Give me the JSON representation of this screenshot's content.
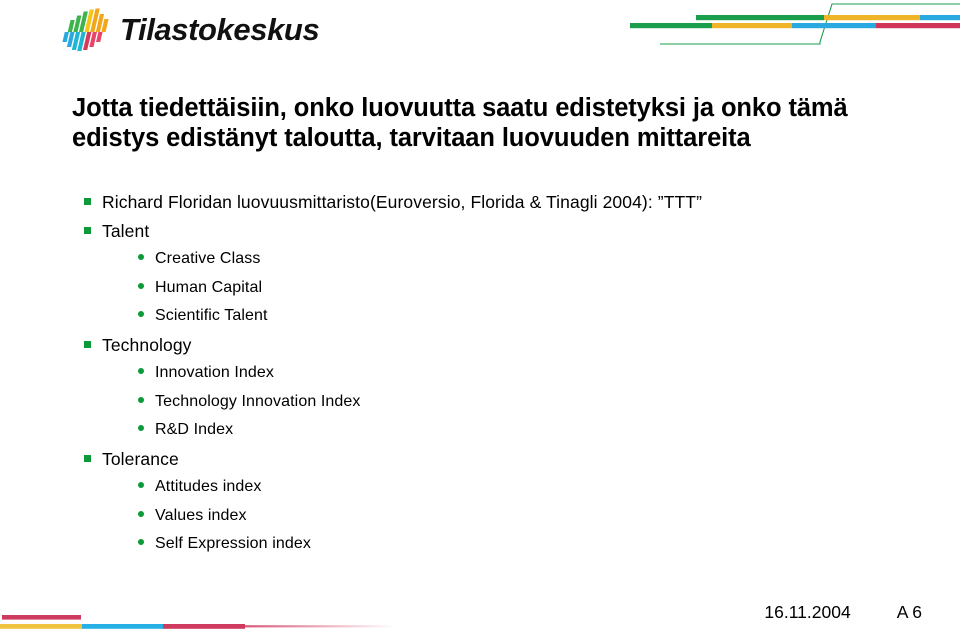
{
  "slide": {
    "brand": {
      "name": "Tilastokeskus",
      "logo_icon": "statistics-bars-logo",
      "logo_colors": [
        "#3cb44b",
        "#f5c518",
        "#f2a61c",
        "#29a9e0",
        "#1fb6d6",
        "#d63a5a",
        "#e8456b"
      ]
    },
    "title": "Jotta tiedettäisiin, onko luovuutta saatu edistetyksi ja onko tämä edistys edistänyt taloutta, tarvitaan luovuuden mittareita",
    "bullets": [
      {
        "level": 1,
        "marker": "square-bullet",
        "text": "Richard Floridan luovuusmittaristo(Euroversio, Florida & Tinagli 2004): ”TTT”"
      },
      {
        "level": 1,
        "marker": "square-bullet",
        "text": "Talent"
      },
      {
        "level": 2,
        "marker": "dot-bullet",
        "text": "Creative Class"
      },
      {
        "level": 2,
        "marker": "dot-bullet",
        "text": "Human Capital"
      },
      {
        "level": 2,
        "marker": "dot-bullet",
        "text": "Scientific Talent"
      },
      {
        "level": 1,
        "marker": "square-bullet",
        "text": "Technology"
      },
      {
        "level": 2,
        "marker": "dot-bullet",
        "text": "Innovation Index"
      },
      {
        "level": 2,
        "marker": "dot-bullet",
        "text": "Technology Innovation Index"
      },
      {
        "level": 2,
        "marker": "dot-bullet",
        "text": "R&D Index"
      },
      {
        "level": 1,
        "marker": "square-bullet",
        "text": "Tolerance"
      },
      {
        "level": 2,
        "marker": "dot-bullet",
        "text": "Attitudes index"
      },
      {
        "level": 2,
        "marker": "dot-bullet",
        "text": "Values index"
      },
      {
        "level": 2,
        "marker": "dot-bullet",
        "text": "Self Expression index"
      }
    ],
    "footer": {
      "date": "16.11.2004",
      "slide_id": "A 6"
    },
    "decoration": {
      "header_bar_colors": [
        "#1a9e4b",
        "#f0b429",
        "#29a9e0",
        "#d0365a"
      ],
      "footer_bar_colors": [
        "#cf3b5e",
        "#efc340",
        "#27b0e6",
        "#cf3b5e"
      ],
      "accent_green": "#1a9e4b",
      "bullet_green": "#0b9a37"
    }
  }
}
